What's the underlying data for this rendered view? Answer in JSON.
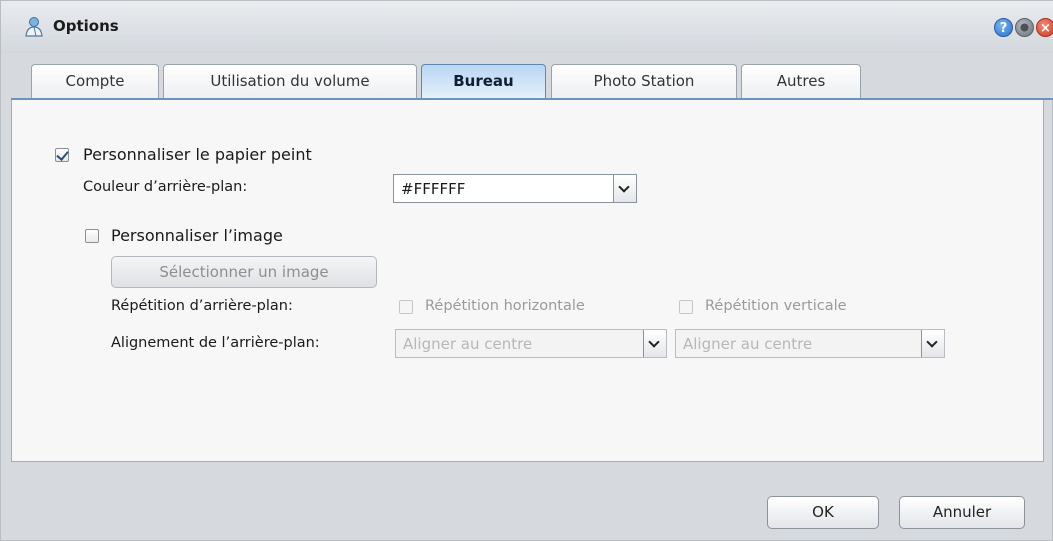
{
  "window": {
    "title": "Options",
    "icons": {
      "app": "synology-person-icon",
      "help": "help-icon",
      "minimize": "minimize-icon",
      "close": "close-icon"
    },
    "help_glyph": "?",
    "close_glyph": "×"
  },
  "tabs": [
    {
      "label": "Compte",
      "active": false
    },
    {
      "label": "Utilisation du volume",
      "active": false
    },
    {
      "label": "Bureau",
      "active": true
    },
    {
      "label": "Photo Station",
      "active": false
    },
    {
      "label": "Autres",
      "active": false
    }
  ],
  "desktop": {
    "customize_wallpaper": {
      "label": "Personnaliser le papier peint",
      "checked": true
    },
    "bg_color": {
      "label": "Couleur d’arrière-plan:",
      "value": "#FFFFFF"
    },
    "customize_image": {
      "label": "Personnaliser l’image",
      "checked": false
    },
    "select_image_button": "Sélectionner un image",
    "repeat": {
      "label": "Répétition d’arrière-plan:",
      "horizontal": {
        "label": "Répétition horizontale",
        "checked": false
      },
      "vertical": {
        "label": "Répétition verticale",
        "checked": false
      }
    },
    "alignment": {
      "label": "Alignement de l’arrière-plan:",
      "horizontal_value": "Aligner au centre",
      "vertical_value": "Aligner au centre"
    }
  },
  "footer": {
    "ok": "OK",
    "cancel": "Annuler"
  },
  "colors": {
    "accent": "#6c93bc",
    "active_tab": "#b9d6f2",
    "help": "#2c6fc4",
    "close": "#cf3a22"
  }
}
